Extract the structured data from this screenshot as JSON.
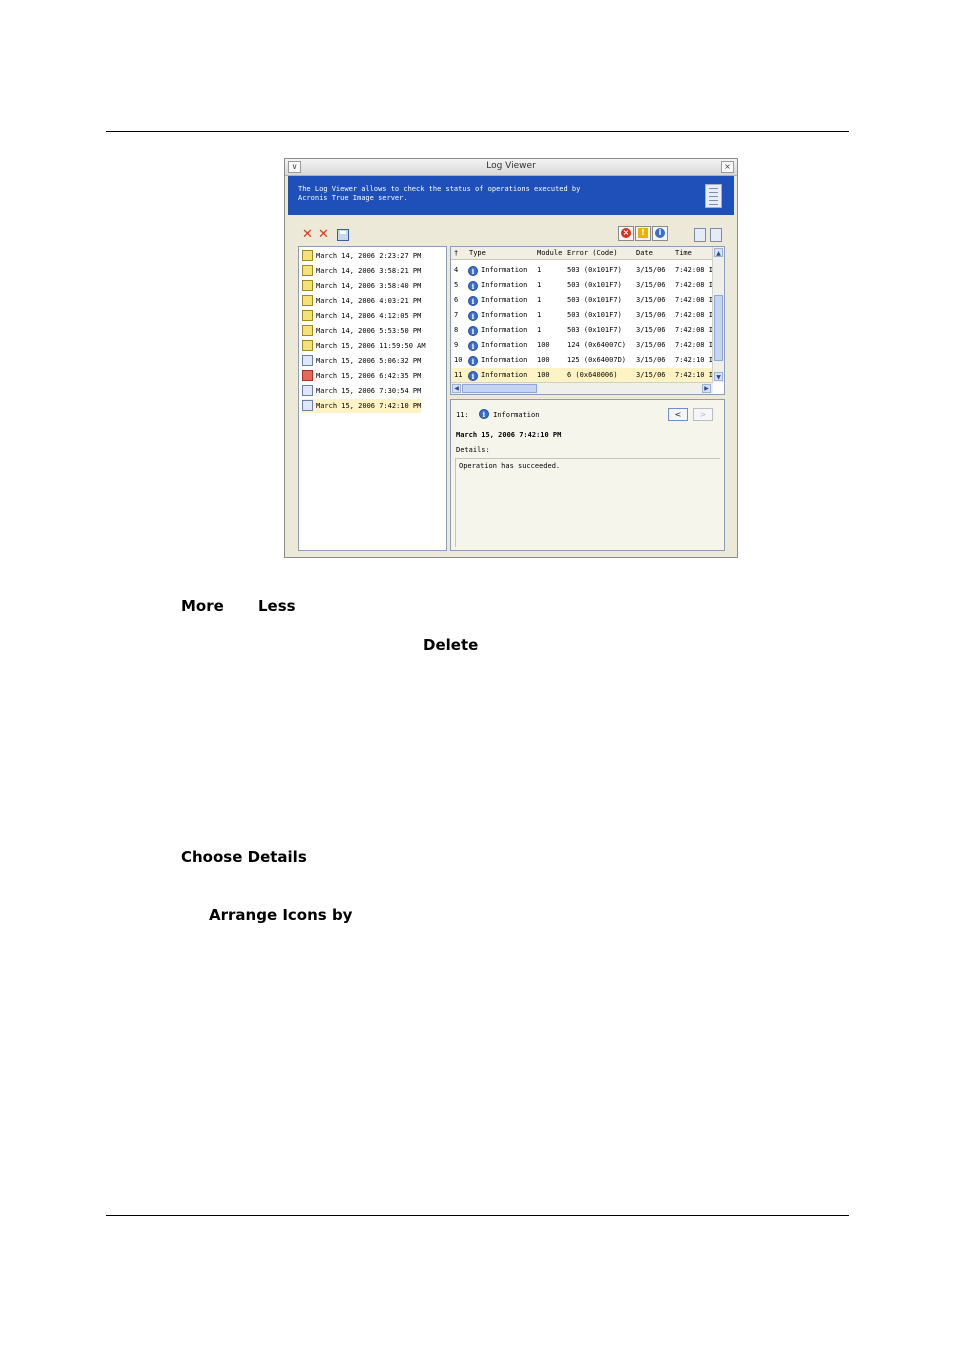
{
  "window": {
    "title": "Log Viewer",
    "banner_line1": "The Log Viewer allows to check the status of operations executed by",
    "banner_line2": "Acronis True Image server."
  },
  "sessions": [
    {
      "label": "March 14, 2006 2:23:27 PM",
      "icon": "log-warning-icon"
    },
    {
      "label": "March 14, 2006 3:58:21 PM",
      "icon": "log-warning-icon"
    },
    {
      "label": "March 14, 2006 3:58:40 PM",
      "icon": "log-warning-icon"
    },
    {
      "label": "March 14, 2006 4:03:21 PM",
      "icon": "log-warning-icon"
    },
    {
      "label": "March 14, 2006 4:12:05 PM",
      "icon": "log-warning-icon"
    },
    {
      "label": "March 14, 2006 5:53:50 PM",
      "icon": "log-warning-icon"
    },
    {
      "label": "March 15, 2006 11:59:50 AM",
      "icon": "log-warning-icon"
    },
    {
      "label": "March 15, 2006 5:06:32 PM",
      "icon": "log-icon"
    },
    {
      "label": "March 15, 2006 6:42:35 PM",
      "icon": "log-error-icon"
    },
    {
      "label": "March 15, 2006 7:30:54 PM",
      "icon": "log-icon"
    },
    {
      "label": "March 15, 2006 7:42:10 PM",
      "icon": "log-icon",
      "selected": true
    }
  ],
  "table": {
    "columns": [
      "†",
      "Type",
      "Module",
      "Error (Code)",
      "Date",
      "Time"
    ],
    "rows": [
      {
        "num": "4",
        "type": "Information",
        "module": "1",
        "error": "503 (0x101F7)",
        "date": "3/15/06",
        "time": "7:42:08 I"
      },
      {
        "num": "5",
        "type": "Information",
        "module": "1",
        "error": "503 (0x101F7)",
        "date": "3/15/06",
        "time": "7:42:08 I"
      },
      {
        "num": "6",
        "type": "Information",
        "module": "1",
        "error": "503 (0x101F7)",
        "date": "3/15/06",
        "time": "7:42:08 I"
      },
      {
        "num": "7",
        "type": "Information",
        "module": "1",
        "error": "503 (0x101F7)",
        "date": "3/15/06",
        "time": "7:42:08 I"
      },
      {
        "num": "8",
        "type": "Information",
        "module": "1",
        "error": "503 (0x101F7)",
        "date": "3/15/06",
        "time": "7:42:08 I"
      },
      {
        "num": "9",
        "type": "Information",
        "module": "100",
        "error": "124 (0x64007C)",
        "date": "3/15/06",
        "time": "7:42:08 I"
      },
      {
        "num": "10",
        "type": "Information",
        "module": "100",
        "error": "125 (0x64007D)",
        "date": "3/15/06",
        "time": "7:42:10 I"
      },
      {
        "num": "11",
        "type": "Information",
        "module": "100",
        "error": "6 (0x640006)",
        "date": "3/15/06",
        "time": "7:42:10 I",
        "selected": true
      }
    ]
  },
  "detail": {
    "entry_num": "11:",
    "entry_type": "Information",
    "timestamp": "March 15, 2006 7:42:10 PM",
    "details_label": "Details:",
    "message": "Operation has succeeded.",
    "prev_label": "<",
    "next_label": ">"
  },
  "body": {
    "more": "More",
    "less": "Less",
    "delete": "Delete",
    "choose_details": "Choose Details",
    "arrange_icons_by": "Arrange Icons by"
  }
}
